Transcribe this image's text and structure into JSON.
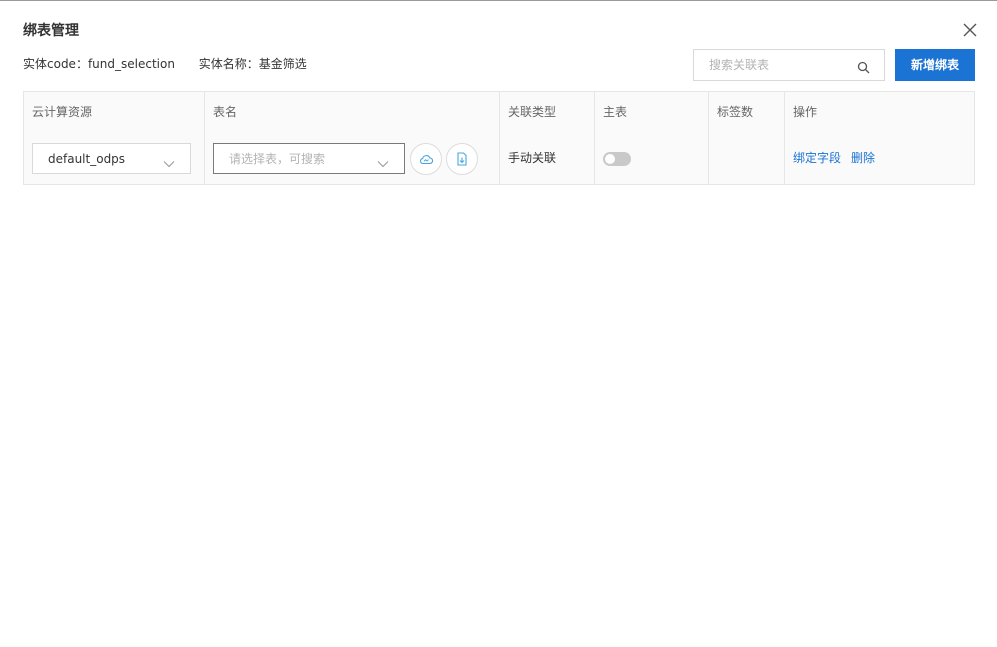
{
  "dialog": {
    "title": "绑表管理"
  },
  "meta": {
    "entity_code_label": "实体code：",
    "entity_code_value": "fund_selection",
    "entity_name_label": "实体名称：",
    "entity_name_value": "基金筛选"
  },
  "search": {
    "placeholder": "搜索关联表"
  },
  "actions": {
    "add_label": "新增绑表"
  },
  "table": {
    "columns": [
      "云计算资源",
      "表名",
      "关联类型",
      "主表",
      "标签数",
      "操作"
    ],
    "rows": [
      {
        "resource": "default_odps",
        "table_name_placeholder": "请选择表，可搜索",
        "link_type": "手动关联",
        "is_main": false,
        "tag_count": "",
        "ops": [
          "绑定字段",
          "删除"
        ]
      }
    ]
  },
  "colors": {
    "primary": "#1b73d3",
    "icon": "#4aa6e0",
    "toggle_off": "#c9c9c9"
  },
  "icons": [
    "close-icon",
    "search-icon",
    "chevron-down-icon",
    "cloud-icon",
    "file-upload-icon"
  ]
}
